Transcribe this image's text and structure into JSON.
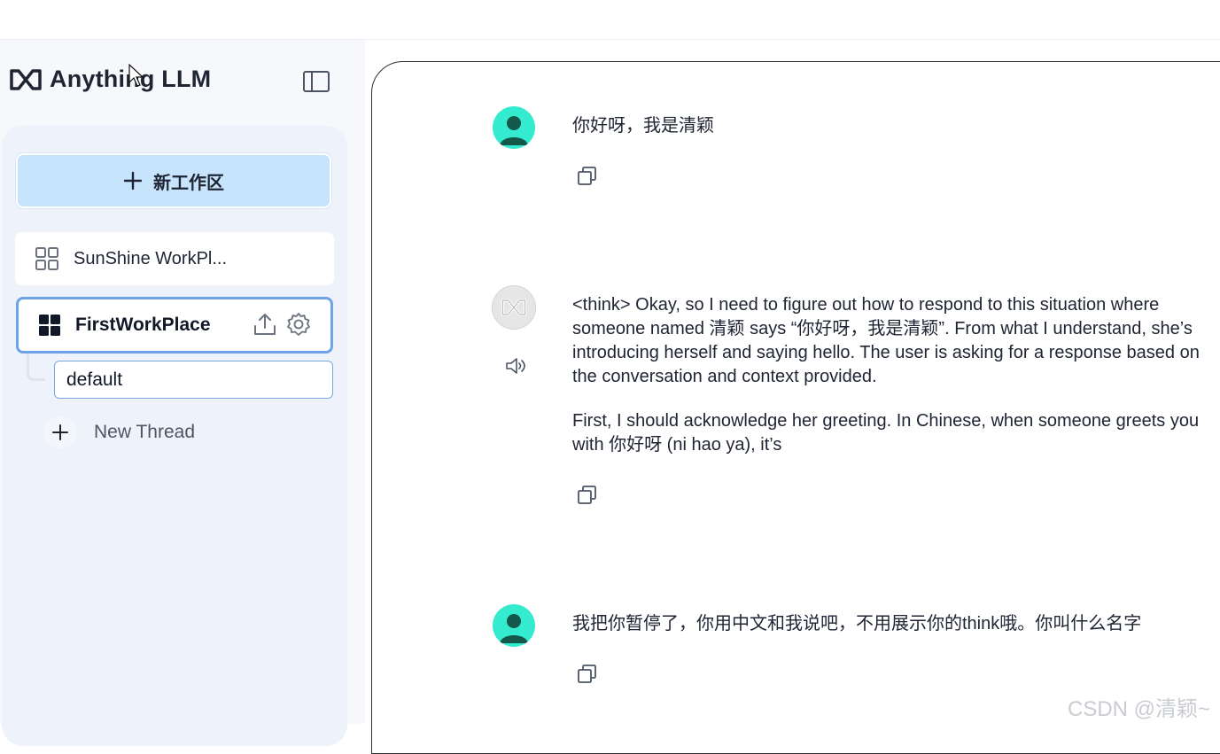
{
  "app": {
    "brand": "Anything LLM"
  },
  "sidebar": {
    "new_workspace_label": "新工作区",
    "workspaces": [
      {
        "label": "SunShine WorkPl..."
      },
      {
        "label": "FirstWorkPlace",
        "active": true
      }
    ],
    "threads": [
      {
        "label": "default"
      }
    ],
    "new_thread_label": "New Thread"
  },
  "chat": {
    "messages": [
      {
        "role": "user",
        "text": "你好呀，我是清颖"
      },
      {
        "role": "assistant",
        "paragraphs": [
          "<think> Okay, so I need to figure out how to respond to this situation where someone named 清颖 says “你好呀，我是清颖”. From what I understand, she’s introducing herself and saying hello. The user is asking for a response based on the conversation and context provided.",
          "First, I should acknowledge her greeting. In Chinese, when someone greets you with 你好呀 (ni hao ya), it’s"
        ]
      },
      {
        "role": "user",
        "text": "我把你暂停了，你用中文和我说吧，不用展示你的think哦。你叫什么名字"
      }
    ]
  },
  "watermark": "CSDN @清颖~",
  "colors": {
    "accent": "#6fa3e8",
    "new_ws_bg": "#c6e4fc",
    "avatar": "#34ebd0"
  }
}
